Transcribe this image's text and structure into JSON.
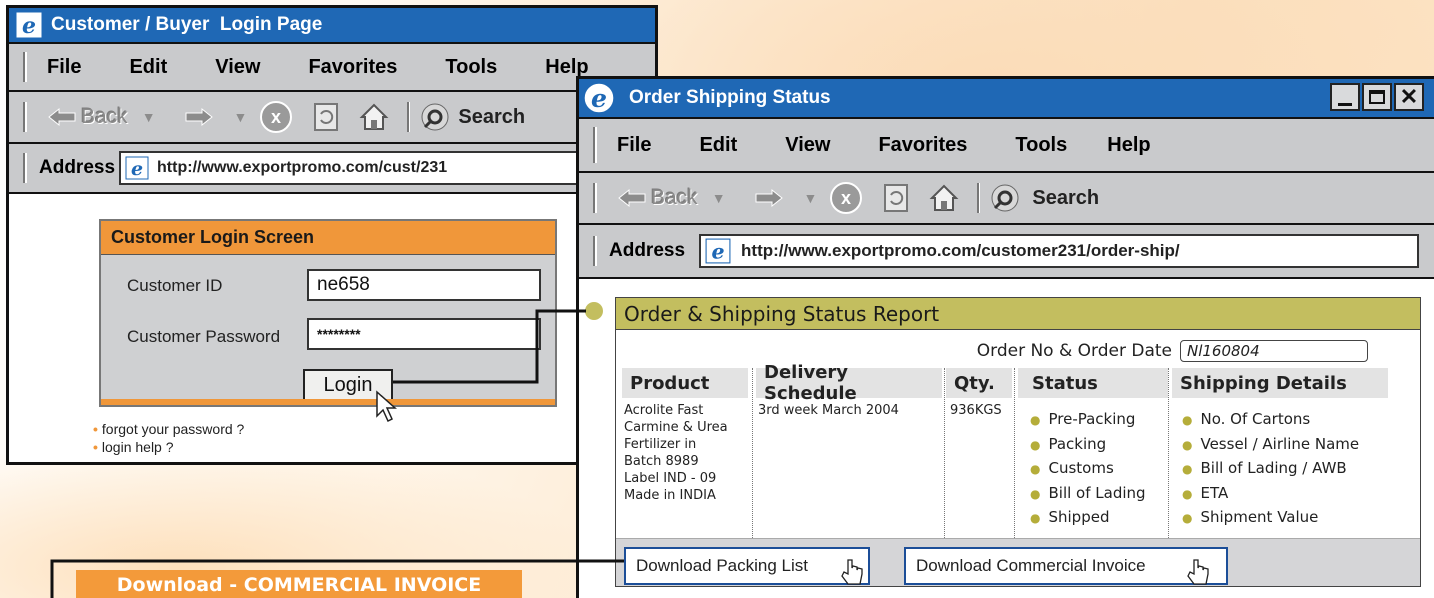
{
  "login_window": {
    "title": "Customer / Buyer  Login Page",
    "menu": [
      "File",
      "Edit",
      "View",
      "Favorites",
      "Tools",
      "Help"
    ],
    "toolbar": {
      "back_label": "Back",
      "search_label": "Search"
    },
    "address_label": "Address",
    "address_url": "http://www.exportpromo.com/cust/231",
    "panel": {
      "heading": "Customer Login Screen",
      "customer_id_label": "Customer ID",
      "customer_id_value": "ne658",
      "password_label": "Customer Password",
      "password_value": "********",
      "login_button": "Login"
    },
    "links": [
      "forgot your password ?",
      "login help ?"
    ]
  },
  "status_window": {
    "title": "Order Shipping Status",
    "menu": [
      "File",
      "Edit",
      "View",
      "Favorites",
      "Tools",
      "Help"
    ],
    "toolbar": {
      "back_label": "Back",
      "search_label": "Search"
    },
    "address_label": "Address",
    "address_url": "http://www.exportpromo.com/customer231/order-ship/",
    "report": {
      "heading": "Order & Shipping Status Report",
      "order_label": "Order No & Order Date",
      "order_value": "Nl160804",
      "columns": [
        "Product",
        "Delivery Schedule",
        "Qty.",
        "Status",
        "Shipping Details"
      ],
      "product_lines": [
        "Acrolite Fast",
        "Carmine & Urea",
        "Fertilizer in",
        "Batch 8989",
        "Label IND - 09",
        "Made in INDIA"
      ],
      "delivery_schedule": "3rd week March 2004",
      "quantity": "936KGS",
      "status_items": [
        "Pre-Packing",
        "Packing",
        "Customs",
        "Bill of Lading",
        "Shipped"
      ],
      "shipping_items": [
        "No. Of Cartons",
        "Vessel / Airline Name",
        "Bill of Lading / AWB",
        "ETA",
        "Shipment Value"
      ]
    },
    "buttons": {
      "packing_list": "Download Packing List",
      "commercial_invoice": "Download Commercial Invoice"
    }
  },
  "invoice_banner": "Download - COMMERCIAL INVOICE",
  "colors": {
    "titlebar": "#1f68b5",
    "chrome": "#c9cacc",
    "orange": "#f0973a",
    "olive": "#c3be5f",
    "button_border": "#1c4e98"
  },
  "icons": [
    "ie-logo-icon",
    "back-arrow-icon",
    "forward-arrow-icon",
    "stop-icon",
    "refresh-icon",
    "home-icon",
    "search-icon",
    "hand-cursor-icon",
    "arrow-cursor-icon",
    "minimize-icon",
    "maximize-icon",
    "close-icon"
  ]
}
